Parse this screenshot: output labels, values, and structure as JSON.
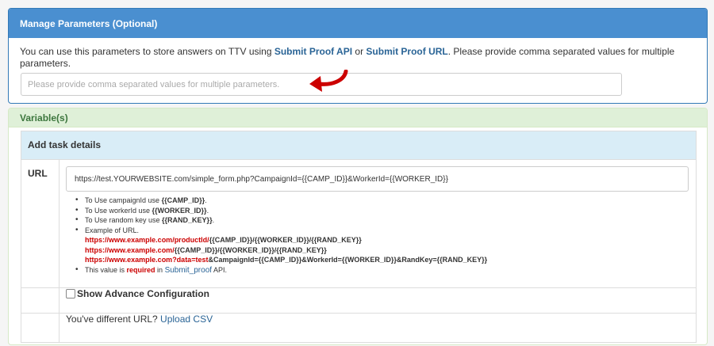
{
  "params_panel": {
    "title": "Manage Parameters (Optional)",
    "desc_prefix": "You can use this parameters to store answers on TTV using ",
    "link_api": "Submit Proof API",
    "desc_or": " or ",
    "link_url": "Submit Proof URL",
    "desc_suffix": ". Please provide comma separated values for multiple parameters.",
    "input_placeholder": "Please provide comma separated values for multiple parameters."
  },
  "variables_panel": {
    "title": "Variable(s)",
    "table_title": "Add task details",
    "url_label": "URL",
    "url_value": "https://test.YOURWEBSITE.com/simple_form.php?CampaignId={{CAMP_ID}}&WorkerId={{WORKER_ID}}",
    "notes": {
      "camp_prefix": "To Use campaignId use ",
      "camp_code": "{{CAMP_ID}}",
      "worker_prefix": "To Use workerId use ",
      "worker_code": "{{WORKER_ID}}",
      "rand_prefix": "To Use random key use ",
      "rand_code": "{{RAND_KEY}}",
      "example_label": "Example of URL.",
      "ex1_red": "https://www.example.com/productId/",
      "ex1_rest": "{{CAMP_ID}}/{{WORKER_ID}}/{{RAND_KEY}}",
      "ex2_red": "https://www.example.com/",
      "ex2_rest": "{{CAMP_ID}}/{{WORKER_ID}}/{{RAND_KEY}}",
      "ex3_red": "https://www.example.com?data=test",
      "ex3_rest": "&CampaignId={{CAMP_ID}}&WorkerId={{WORKER_ID}}&RandKey={{RAND_KEY}}",
      "req_prefix": "This value is ",
      "req_word": "required",
      "req_in": " in ",
      "req_link": "Submit_proof",
      "req_suffix": " API."
    },
    "advance_label": "Show Advance Configuration",
    "csv_prefix": "You've different URL? ",
    "csv_link": "Upload CSV"
  },
  "colors": {
    "params_heading": "#4a8fd0",
    "vars_heading": "#dff0d8",
    "table_heading": "#d9edf7",
    "arrow": "#cc0000",
    "link": "#2a6496"
  }
}
